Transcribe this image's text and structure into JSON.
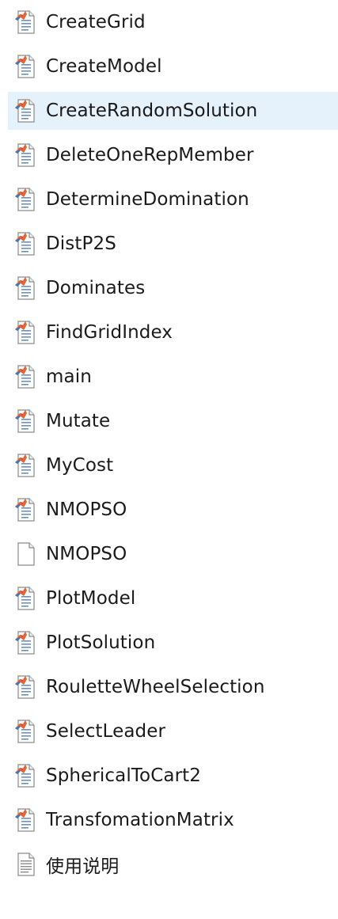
{
  "files": [
    {
      "name": "CreateGrid",
      "icon": "matlab-script-icon",
      "selected": false
    },
    {
      "name": "CreateModel",
      "icon": "matlab-script-icon",
      "selected": false
    },
    {
      "name": "CreateRandomSolution",
      "icon": "matlab-script-icon",
      "selected": true
    },
    {
      "name": "DeleteOneRepMember",
      "icon": "matlab-script-icon",
      "selected": false
    },
    {
      "name": "DetermineDomination",
      "icon": "matlab-script-icon",
      "selected": false
    },
    {
      "name": "DistP2S",
      "icon": "matlab-script-icon",
      "selected": false
    },
    {
      "name": "Dominates",
      "icon": "matlab-script-icon",
      "selected": false
    },
    {
      "name": "FindGridIndex",
      "icon": "matlab-script-icon",
      "selected": false
    },
    {
      "name": "main",
      "icon": "matlab-script-icon",
      "selected": false
    },
    {
      "name": "Mutate",
      "icon": "matlab-script-icon",
      "selected": false
    },
    {
      "name": "MyCost",
      "icon": "matlab-script-icon",
      "selected": false
    },
    {
      "name": "NMOPSO",
      "icon": "matlab-script-icon",
      "selected": false
    },
    {
      "name": "NMOPSO",
      "icon": "blank-file-icon",
      "selected": false
    },
    {
      "name": "PlotModel",
      "icon": "matlab-script-icon",
      "selected": false
    },
    {
      "name": "PlotSolution",
      "icon": "matlab-script-icon",
      "selected": false
    },
    {
      "name": "RouletteWheelSelection",
      "icon": "matlab-script-icon",
      "selected": false
    },
    {
      "name": "SelectLeader",
      "icon": "matlab-script-icon",
      "selected": false
    },
    {
      "name": "SphericalToCart2",
      "icon": "matlab-script-icon",
      "selected": false
    },
    {
      "name": "TransfomationMatrix",
      "icon": "matlab-script-icon",
      "selected": false
    },
    {
      "name": "使用说明",
      "icon": "text-document-icon",
      "selected": false
    }
  ],
  "colors": {
    "selection_background": "#e5f1fb",
    "text": "#1a1a1a"
  }
}
